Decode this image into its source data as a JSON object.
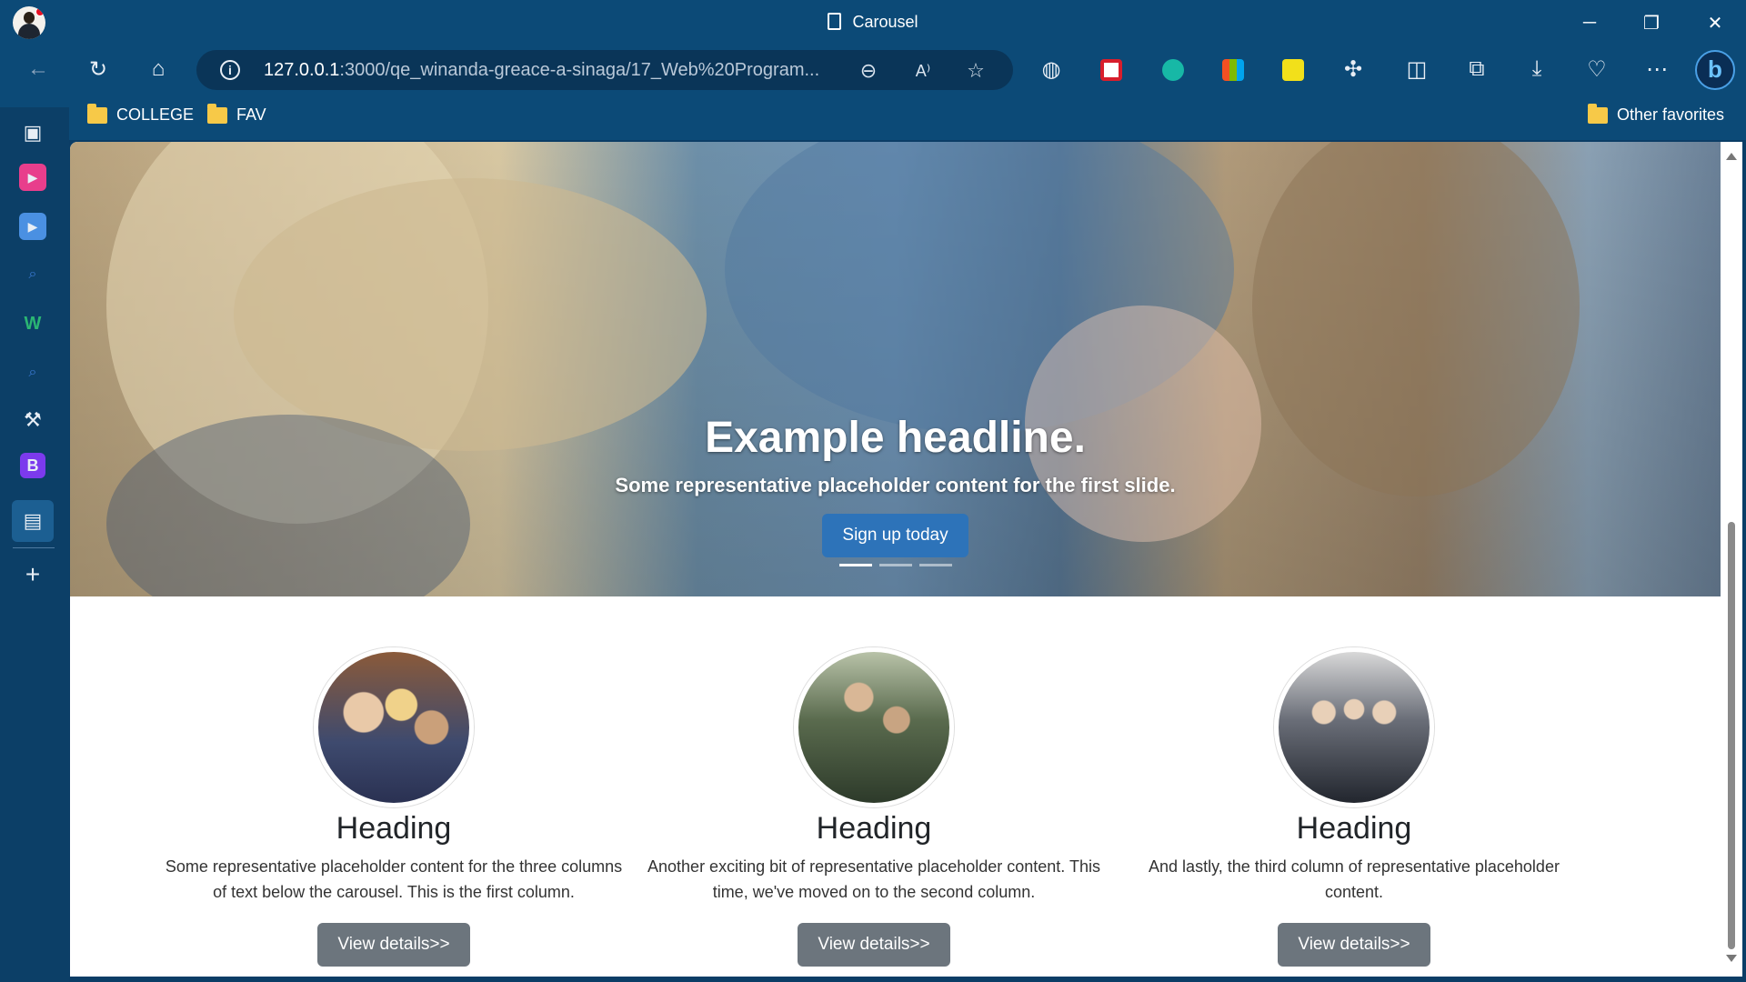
{
  "window": {
    "title": "Carousel",
    "controls": {
      "minimize": "─",
      "restore": "❐",
      "close": "✕"
    }
  },
  "toolbar": {
    "url_host": "127.0.0.1",
    "url_path": ":3000/qe_winanda-greace-a-sinaga/17_Web%20Program...",
    "copilot_label": "b"
  },
  "bookmarks": {
    "items": [
      {
        "label": "COLLEGE"
      },
      {
        "label": "FAV"
      }
    ],
    "other": "Other favorites"
  },
  "sidebar": {
    "items": [
      "tabs-icon",
      "video-icon",
      "play-icon",
      "search-icon",
      "w-icon",
      "search-icon",
      "tools-icon",
      "b-icon",
      "document-icon"
    ],
    "b_label": "B",
    "w_label": "W"
  },
  "hero": {
    "headline": "Example headline.",
    "subtext": "Some representative placeholder content for the first slide.",
    "button": "Sign up today",
    "active_slide": 1,
    "slide_count": 3
  },
  "columns": [
    {
      "heading": "Heading",
      "text": "Some representative placeholder content for the three columns of text below the carousel. This is the first column.",
      "button": "View details>>"
    },
    {
      "heading": "Heading",
      "text": "Another exciting bit of representative placeholder content. This time, we've moved on to the second column.",
      "button": "View details>>"
    },
    {
      "heading": "Heading",
      "text": "And lastly, the third column of representative placeholder content.",
      "button": "View details>>"
    }
  ],
  "colors": {
    "browser_chrome": "#0c4a77",
    "primary_button": "#2d73b9",
    "secondary_button": "#6c757d"
  }
}
